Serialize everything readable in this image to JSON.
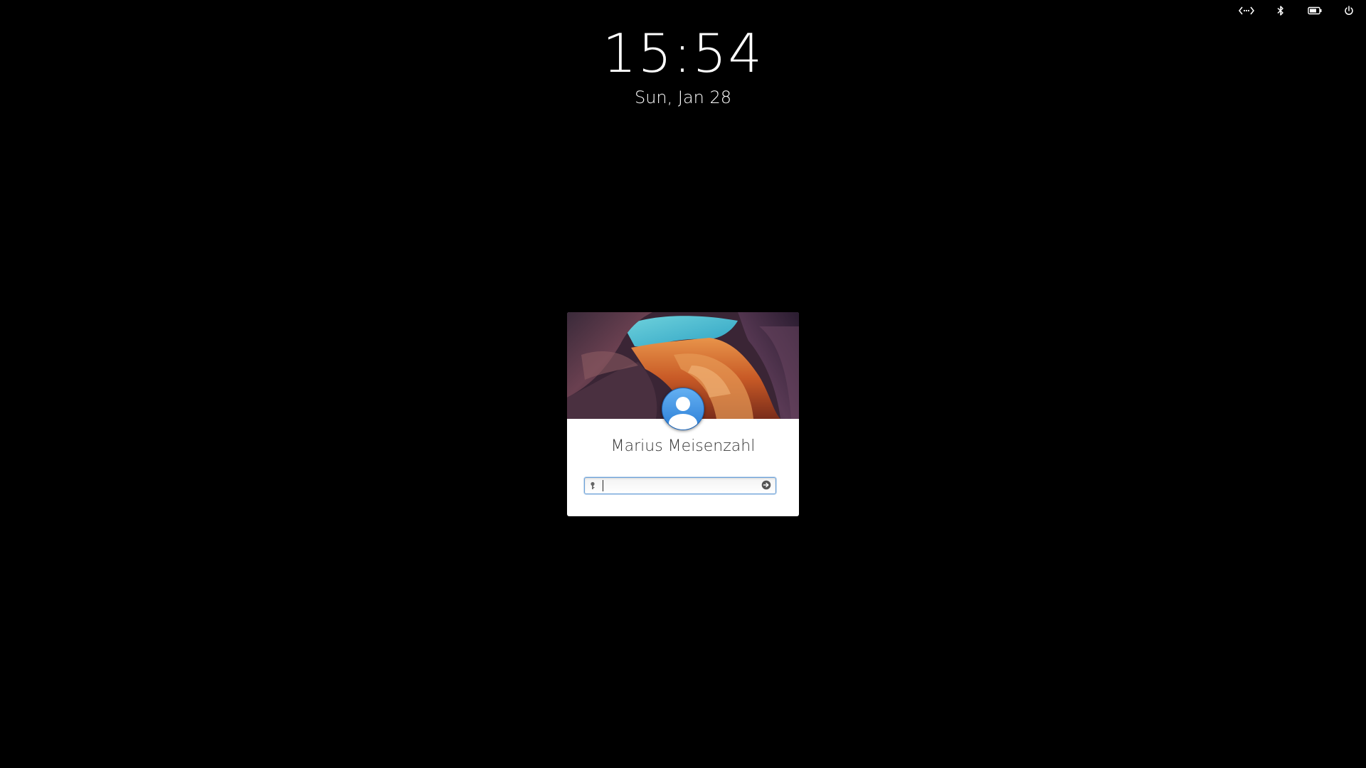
{
  "indicators": {
    "network_icon": "network-wired-icon",
    "bluetooth_icon": "bluetooth-icon",
    "battery_icon": "battery-icon",
    "power_icon": "power-icon"
  },
  "clock": {
    "time": "15:54",
    "date": "Sun, Jan 28"
  },
  "login": {
    "user_name": "Marius Meisenzahl",
    "avatar_icon": "user-avatar-icon",
    "background_image": "canyon-wallpaper",
    "password_value": "",
    "password_placeholder": "",
    "key_icon": "key-icon",
    "submit_icon": "go-arrow-icon"
  },
  "colors": {
    "background": "#000000",
    "card": "#ffffff",
    "avatar_blue": "#3b8ee3",
    "focus_border": "#6aa0d8"
  }
}
